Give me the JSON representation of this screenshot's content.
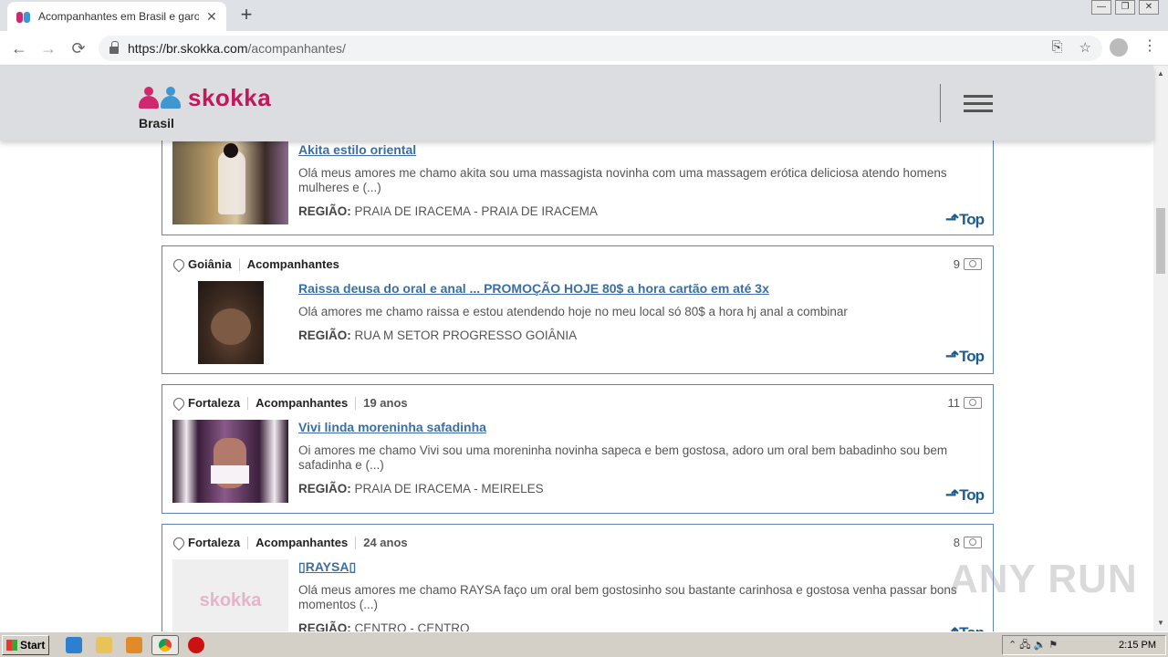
{
  "browser": {
    "tab_title": "Acompanhantes em Brasil e garotas",
    "tab_close": "✕",
    "new_tab": "+",
    "url_host": "https://br.skokka.com",
    "url_path": "/acompanhantes/",
    "back": "←",
    "forward": "→",
    "reload": "⟳",
    "menu": "⋮",
    "window_controls": [
      "—",
      "❐",
      "✕"
    ]
  },
  "site": {
    "logo_text": "skokka",
    "country": "Brasil"
  },
  "listings": [
    {
      "title": "Akita estilo oriental",
      "description": "Olá meus amores me chamo akita sou uma massagista novinha com uma massagem erótica deliciosa atendo homens mulheres e (...)",
      "region_label": "REGIÃO:",
      "region": "PRAIA DE IRACEMA - PRAIA DE IRACEMA",
      "top": "Top"
    },
    {
      "city": "Goiânia",
      "category": "Acompanhantes",
      "photos": "9",
      "title": "Raissa deusa do oral e anal ... PROMOÇÃO HOJE 80$ a hora cartão em até 3x",
      "description": "Olá amores me chamo raissa e estou atendendo hoje no meu local só 80$ a hora hj anal a combinar",
      "region_label": "REGIÃO:",
      "region": "RUA M SETOR PROGRESSO GOIÂNIA",
      "top": "Top"
    },
    {
      "city": "Fortaleza",
      "category": "Acompanhantes",
      "age": "19 anos",
      "photos": "11",
      "title": "Vivi linda moreninha safadinha",
      "description": "Oi amores me chamo Vivi sou uma moreninha novinha sapeca e bem gostosa, adoro um oral bem babadinho sou bem safadinha e (...)",
      "region_label": "REGIÃO:",
      "region": "PRAIA DE IRACEMA - MEIRELES",
      "top": "Top"
    },
    {
      "city": "Fortaleza",
      "category": "Acompanhantes",
      "age": "24 anos",
      "photos": "8",
      "title": "RAYSA",
      "description": "Olá meus amores me chamo RAYSA faço um oral bem gostosinho sou bastante carinhosa e gostosa venha passar bons momentos (...)",
      "region_label": "REGIÃO:",
      "region": "CENTRO - CENTRO",
      "placeholder_logo": "skokka",
      "top": "Top"
    }
  ],
  "watermark": "ANY RUN",
  "taskbar": {
    "start": "Start",
    "clock": "2:15 PM"
  }
}
